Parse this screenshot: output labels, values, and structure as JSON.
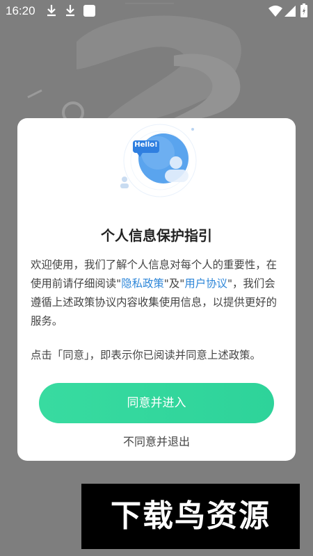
{
  "status_bar": {
    "time": "16:20",
    "icons": [
      "download-icon",
      "download-icon",
      "notification-square-icon",
      "wifi-icon",
      "signal-icon",
      "battery-charging-icon"
    ]
  },
  "dialog": {
    "illustration_bubble_text": "Hello!",
    "title": "个人信息保护指引",
    "body_part1": "欢迎使用，我们了解个人信息对每个人的重要性，在使用前请仔细阅读\"",
    "privacy_link": "隐私政策",
    "body_part2": "\"及\"",
    "agreement_link": "用户协议",
    "body_part3": "\"，我们会遵循上述政策协议内容收集使用信息，以提供更好的服务。",
    "body_paragraph2": "点击「同意」，即表示你已阅读并同意上述政策。",
    "agree_label": "同意并进入",
    "disagree_label": "不同意并退出"
  },
  "watermark": {
    "text": "下载鸟资源"
  },
  "colors": {
    "accent_green": "#34d89d",
    "link_blue": "#2d86d8",
    "overlay": "#7e7e7e"
  }
}
